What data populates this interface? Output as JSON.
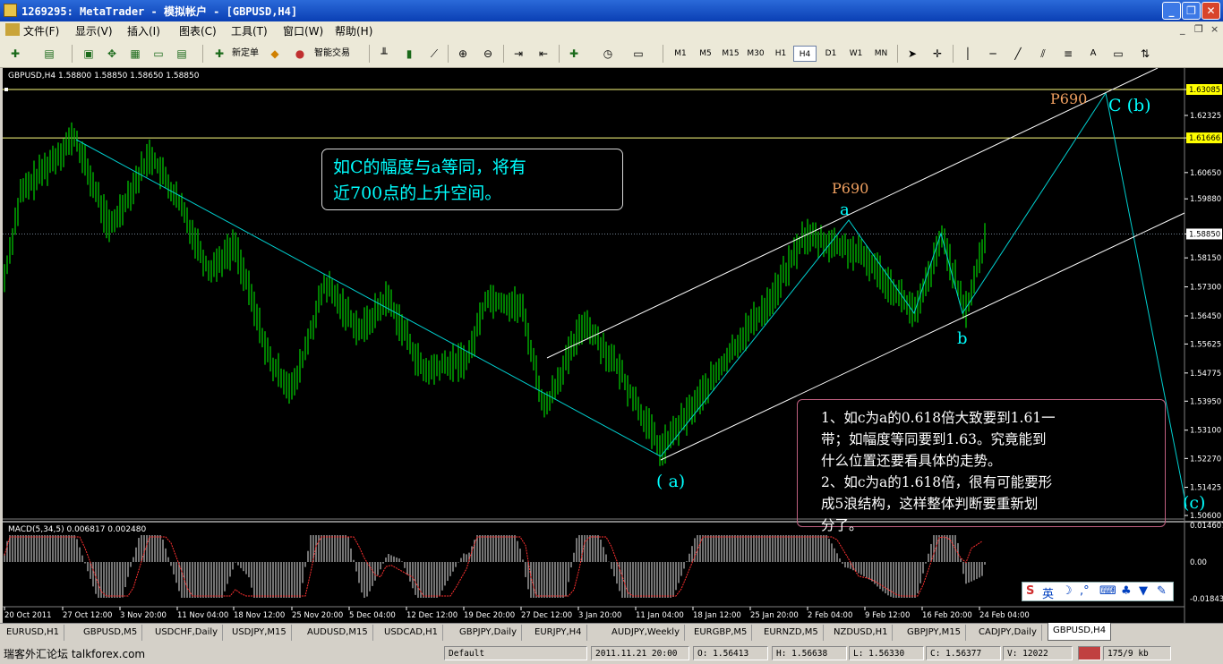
{
  "window": {
    "title": "1269295: MetaTrader - 模拟帐户 - [GBPUSD,H4]",
    "minimize": "_",
    "restore": "❐",
    "close": "✕"
  },
  "menu": {
    "items": [
      "文件(F)",
      "显示(V)",
      "插入(I)",
      "图表(C)",
      "工具(T)",
      "窗口(W)",
      "帮助(H)"
    ],
    "mdi": [
      "_",
      "❐",
      "×"
    ]
  },
  "toolbar": {
    "new_order": "新定单",
    "expert": "智能交易",
    "timeframes": [
      "M1",
      "M5",
      "M15",
      "M30",
      "H1",
      "H4",
      "D1",
      "W1",
      "MN"
    ],
    "active_tf": "H4",
    "text_tool": "A"
  },
  "chart": {
    "header": "GBPUSD,H4  1.58800 1.58850 1.58650 1.58850",
    "macd_header": "MACD(5,34,5) 0.006817 0.002480",
    "price_labels": [
      "1.63085",
      "1.62325",
      "1.61666",
      "1.60650",
      "1.59880",
      "1.58850",
      "1.58150",
      "1.57300",
      "1.56450",
      "1.55625",
      "1.54775",
      "1.53950",
      "1.53100",
      "1.52270",
      "1.51425",
      "1.50600"
    ],
    "highlight_prices": {
      "top": "1.63085",
      "mid": "1.61666",
      "current": "1.58850"
    },
    "macd_labels": [
      "0.014607",
      "0.00",
      "-0.018435"
    ],
    "time_labels": [
      "20 Oct 2011",
      "27 Oct 12:00",
      "3 Nov 20:00",
      "11 Nov 04:00",
      "18 Nov 12:00",
      "25 Nov 20:00",
      "5 Dec 04:00",
      "12 Dec 12:00",
      "19 Dec 20:00",
      "27 Dec 12:00",
      "3 Jan 20:00",
      "11 Jan 04:00",
      "18 Jan 12:00",
      "25 Jan 20:00",
      "2 Feb 04:00",
      "9 Feb 12:00",
      "16 Feb 20:00",
      "24 Feb 04:00"
    ],
    "wave_labels": {
      "a_paren": "( a)",
      "a": "a",
      "b": "b",
      "c_b": "C (b)",
      "c_paren": "(c)",
      "p690_1": "P690",
      "p690_2": "P690"
    },
    "note1_lines": [
      "如C的幅度与a等同，将有",
      "近700点的上升空间。"
    ],
    "note2_lines": [
      "1、如c为a的0.618倍大致要到1.61一",
      "带；如幅度等同要到1.63。究竟能到",
      "什么位置还要看具体的走势。",
      "2、如c为a的1.618倍，很有可能要形",
      "成5浪结构，这样整体判断要重新划",
      "分了。"
    ],
    "ime": "S 英 ☽ ,° ⌨ ♣ 👕 🔧"
  },
  "colors": {
    "candle": "#00b400",
    "trend": "#00d0d0",
    "channel": "#ffffff",
    "hline": "#ffff80",
    "macd": "#c0c0c0",
    "signal": "#ff3030",
    "orange": "#f0a060"
  },
  "tabs": [
    "EURUSD,H1",
    "GBPUSD,M5",
    "USDCHF,Daily",
    "USDJPY,M15",
    "AUDUSD,M15",
    "USDCAD,H1",
    "GBPJPY,Daily",
    "EURJPY,H4",
    "AUDJPY,Weekly",
    "EURGBP,M5",
    "EURNZD,M5",
    "NZDUSD,H1",
    "GBPJPY,M15",
    "CADJPY,Daily",
    "GBPUSD,H4"
  ],
  "active_tab": "GBPUSD,H4",
  "status": {
    "watermark": "瑞客外汇论坛 talkforex.com",
    "profile": "Default",
    "time": "2011.11.21 20:00",
    "open": "O: 1.56413",
    "high": "H: 1.56638",
    "low": "L: 1.56330",
    "close": "C: 1.56377",
    "volume": "V: 12022",
    "traffic": "175/9 kb"
  }
}
